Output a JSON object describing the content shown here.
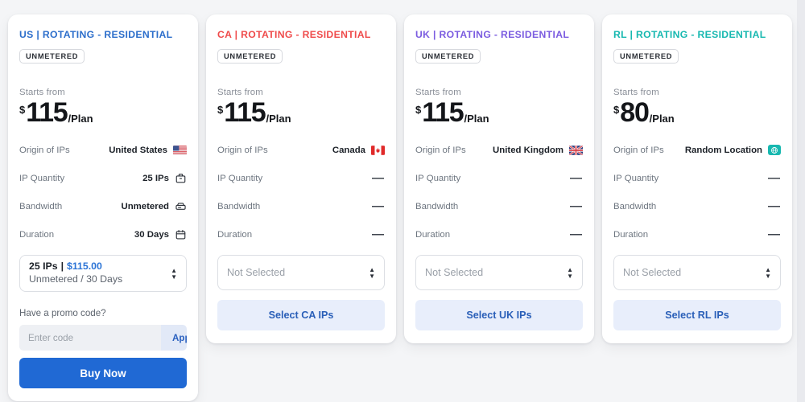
{
  "page": {
    "background": "#f4f5f7"
  },
  "labels": {
    "starts_from": "Starts from",
    "currency": "$",
    "per_plan": "/Plan",
    "origin": "Origin of IPs",
    "ip_quantity": "IP Quantity",
    "bandwidth": "Bandwidth",
    "duration": "Duration",
    "badge": "UNMETERED",
    "dash": "—"
  },
  "promo": {
    "label": "Have a promo code?",
    "placeholder": "Enter code",
    "value": "",
    "apply_label": "Apply",
    "buy_label": "Buy Now"
  },
  "cards": [
    {
      "id": "us",
      "title": "US | ROTATING - RESIDENTIAL",
      "title_color": "#2c6ecb",
      "badge": "UNMETERED",
      "starts_from": "Starts from",
      "currency": "$",
      "price": "115",
      "per": "/Plan",
      "rows": [
        {
          "label": "Origin of IPs",
          "value": "United States",
          "icon": "us-flag-icon"
        },
        {
          "label": "IP Quantity",
          "value": "25 IPs",
          "icon": "package-icon"
        },
        {
          "label": "Bandwidth",
          "value": "Unmetered",
          "icon": "server-icon"
        },
        {
          "label": "Duration",
          "value": "30 Days",
          "icon": "calendar-icon"
        }
      ],
      "selection": {
        "selected": true,
        "line1_qty": "25 IPs",
        "line1_sep": "|",
        "line1_price": "$115.00",
        "line2": "Unmetered / 30 Days"
      },
      "has_promo": true,
      "cta_label": null
    },
    {
      "id": "ca",
      "title": "CA | ROTATING - RESIDENTIAL",
      "title_color": "#ef4b4b",
      "badge": "UNMETERED",
      "starts_from": "Starts from",
      "currency": "$",
      "price": "115",
      "per": "/Plan",
      "rows": [
        {
          "label": "Origin of IPs",
          "value": "Canada",
          "icon": "ca-flag-icon"
        },
        {
          "label": "IP Quantity",
          "value": "—",
          "icon": "none"
        },
        {
          "label": "Bandwidth",
          "value": "—",
          "icon": "none"
        },
        {
          "label": "Duration",
          "value": "—",
          "icon": "none"
        }
      ],
      "selection": {
        "selected": false,
        "placeholder": "Not Selected"
      },
      "has_promo": false,
      "cta_label": "Select CA IPs"
    },
    {
      "id": "uk",
      "title": "UK | ROTATING - RESIDENTIAL",
      "title_color": "#7b5ce0",
      "badge": "UNMETERED",
      "starts_from": "Starts from",
      "currency": "$",
      "price": "115",
      "per": "/Plan",
      "rows": [
        {
          "label": "Origin of IPs",
          "value": "United Kingdom",
          "icon": "uk-flag-icon"
        },
        {
          "label": "IP Quantity",
          "value": "—",
          "icon": "none"
        },
        {
          "label": "Bandwidth",
          "value": "—",
          "icon": "none"
        },
        {
          "label": "Duration",
          "value": "—",
          "icon": "none"
        }
      ],
      "selection": {
        "selected": false,
        "placeholder": "Not Selected"
      },
      "has_promo": false,
      "cta_label": "Select UK IPs"
    },
    {
      "id": "rl",
      "title": "RL | ROTATING - RESIDENTIAL",
      "title_color": "#17b8b0",
      "badge": "UNMETERED",
      "starts_from": "Starts from",
      "currency": "$",
      "price": "80",
      "per": "/Plan",
      "rows": [
        {
          "label": "Origin of IPs",
          "value": "Random Location",
          "icon": "globe-badge-icon"
        },
        {
          "label": "IP Quantity",
          "value": "—",
          "icon": "none"
        },
        {
          "label": "Bandwidth",
          "value": "—",
          "icon": "none"
        },
        {
          "label": "Duration",
          "value": "—",
          "icon": "none"
        }
      ],
      "selection": {
        "selected": false,
        "placeholder": "Not Selected"
      },
      "has_promo": false,
      "cta_label": "Select RL IPs"
    }
  ]
}
